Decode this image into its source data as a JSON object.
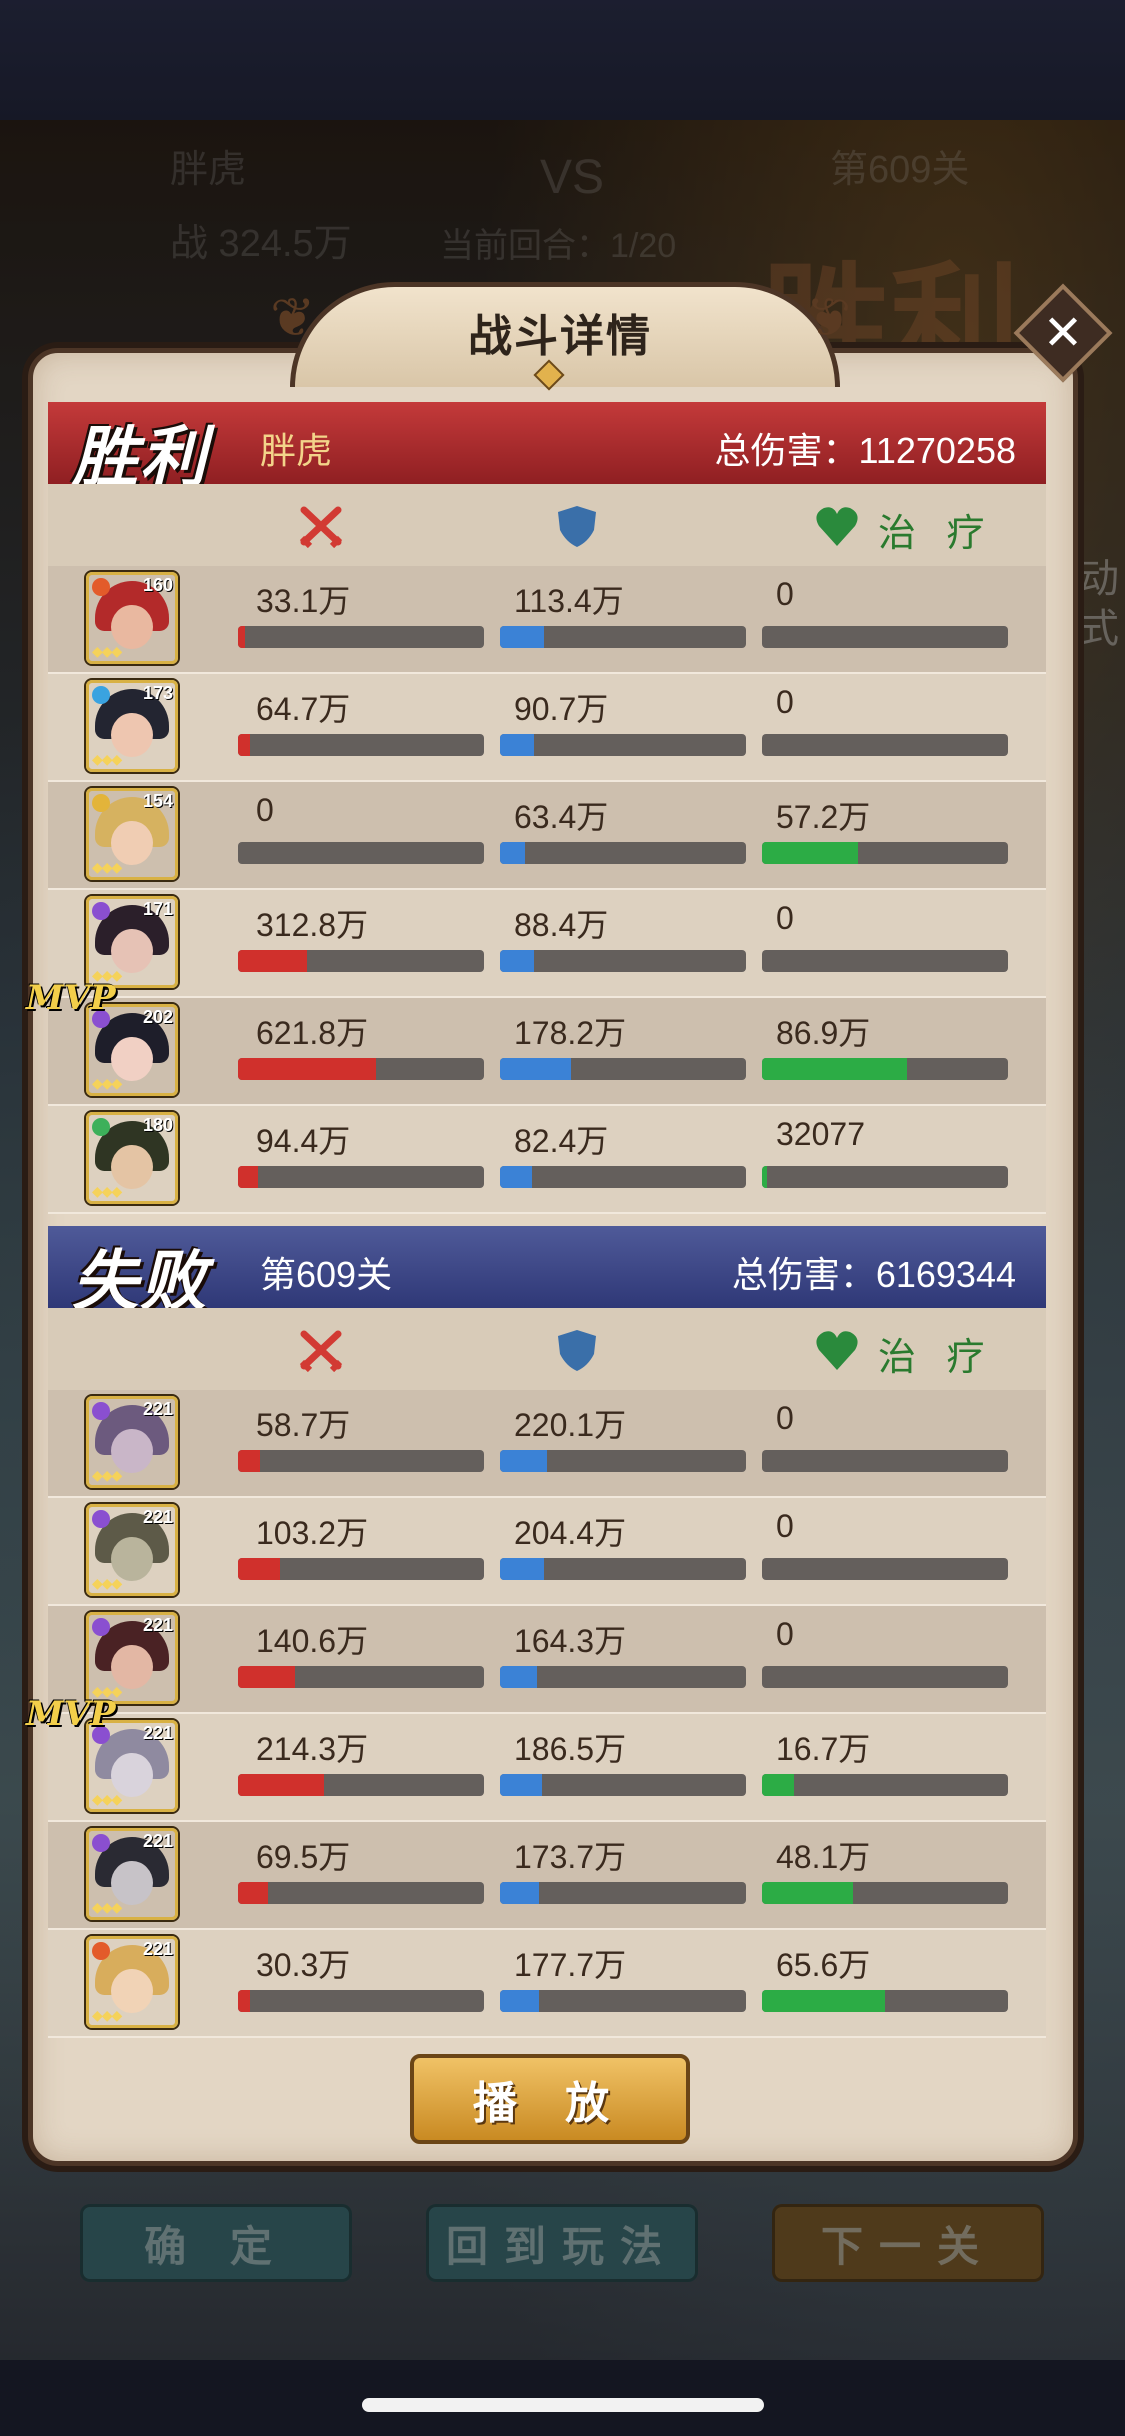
{
  "background": {
    "player_name": "胖虎",
    "vs_label": "VS",
    "power_text": "战 324.5万",
    "round_text": "当前回合：1/20",
    "stage_text": "第609关",
    "victory_text": "胜利",
    "side_text_1": "动",
    "side_text_2": "式",
    "buttons": {
      "confirm": "确 定",
      "back": "回到玩法",
      "next": "下一关"
    }
  },
  "dialog": {
    "title": "战斗详情",
    "close_icon": "close-icon",
    "play_button": "播 放"
  },
  "columns": {
    "heal_label": "治 疗"
  },
  "colors": {
    "win": "#b32c2f",
    "lose": "#3d4788",
    "damage": "#d0302c",
    "defense": "#3b82d6",
    "heal": "#2cac45"
  },
  "win_team": {
    "result": "胜利",
    "name": "胖虎",
    "total": "总伤害：11270258",
    "heroes": [
      {
        "level": "160",
        "mvp": false,
        "damage": "33.1万",
        "defense": "113.4万",
        "heal": "0",
        "damage_pct": 3,
        "defense_pct": 18,
        "heal_pct": 0,
        "skin": "#e9b8a0",
        "hair": "#b32a2a",
        "elem": "#e35b2a"
      },
      {
        "level": "173",
        "mvp": false,
        "damage": "64.7万",
        "defense": "90.7万",
        "heal": "0",
        "damage_pct": 5,
        "defense_pct": 14,
        "heal_pct": 0,
        "skin": "#eec6b0",
        "hair": "#232531",
        "elem": "#3aa3e0"
      },
      {
        "level": "154",
        "mvp": false,
        "damage": "0",
        "defense": "63.4万",
        "heal": "57.2万",
        "damage_pct": 0,
        "defense_pct": 10,
        "heal_pct": 39,
        "skin": "#f0cdb3",
        "hair": "#d6b260",
        "elem": "#e3b43a"
      },
      {
        "level": "171",
        "mvp": false,
        "damage": "312.8万",
        "defense": "88.4万",
        "heal": "0",
        "damage_pct": 28,
        "defense_pct": 14,
        "heal_pct": 0,
        "skin": "#e6c2b5",
        "hair": "#2b1f2a",
        "elem": "#8a4fd0"
      },
      {
        "level": "202",
        "mvp": true,
        "damage": "621.8万",
        "defense": "178.2万",
        "heal": "86.9万",
        "damage_pct": 56,
        "defense_pct": 29,
        "heal_pct": 59,
        "skin": "#f1d0c4",
        "hair": "#1e1e2a",
        "elem": "#8a4fd0"
      },
      {
        "level": "180",
        "mvp": false,
        "damage": "94.4万",
        "defense": "82.4万",
        "heal": "32077",
        "damage_pct": 8,
        "defense_pct": 13,
        "heal_pct": 2,
        "skin": "#e4c4a4",
        "hair": "#2f3523",
        "elem": "#3db05a"
      }
    ]
  },
  "lose_team": {
    "result": "失败",
    "name": "第609关",
    "total": "总伤害：6169344",
    "heroes": [
      {
        "level": "221",
        "mvp": false,
        "damage": "58.7万",
        "defense": "220.1万",
        "heal": "0",
        "damage_pct": 9,
        "defense_pct": 19,
        "heal_pct": 0,
        "skin": "#c9b6c8",
        "hair": "#6c5a7e",
        "elem": "#8a4fd0"
      },
      {
        "level": "221",
        "mvp": false,
        "damage": "103.2万",
        "defense": "204.4万",
        "heal": "0",
        "damage_pct": 17,
        "defense_pct": 18,
        "heal_pct": 0,
        "skin": "#b9b49c",
        "hair": "#5d5a48",
        "elem": "#8a4fd0"
      },
      {
        "level": "221",
        "mvp": false,
        "damage": "140.6万",
        "defense": "164.3万",
        "heal": "0",
        "damage_pct": 23,
        "defense_pct": 15,
        "heal_pct": 0,
        "skin": "#e3b7a4",
        "hair": "#4a2224",
        "elem": "#8a4fd0"
      },
      {
        "level": "221",
        "mvp": true,
        "damage": "214.3万",
        "defense": "186.5万",
        "heal": "16.7万",
        "damage_pct": 35,
        "defense_pct": 17,
        "heal_pct": 13,
        "skin": "#d9d3dc",
        "hair": "#8f8aa0",
        "elem": "#8a4fd0"
      },
      {
        "level": "221",
        "mvp": false,
        "damage": "69.5万",
        "defense": "173.7万",
        "heal": "48.1万",
        "damage_pct": 12,
        "defense_pct": 16,
        "heal_pct": 37,
        "skin": "#c7c3c8",
        "hair": "#2a2a33",
        "elem": "#8a4fd0"
      },
      {
        "level": "221",
        "mvp": false,
        "damage": "30.3万",
        "defense": "177.7万",
        "heal": "65.6万",
        "damage_pct": 5,
        "defense_pct": 16,
        "heal_pct": 50,
        "skin": "#f1d3b6",
        "hair": "#d8ad5c",
        "elem": "#e35b2a"
      }
    ]
  }
}
